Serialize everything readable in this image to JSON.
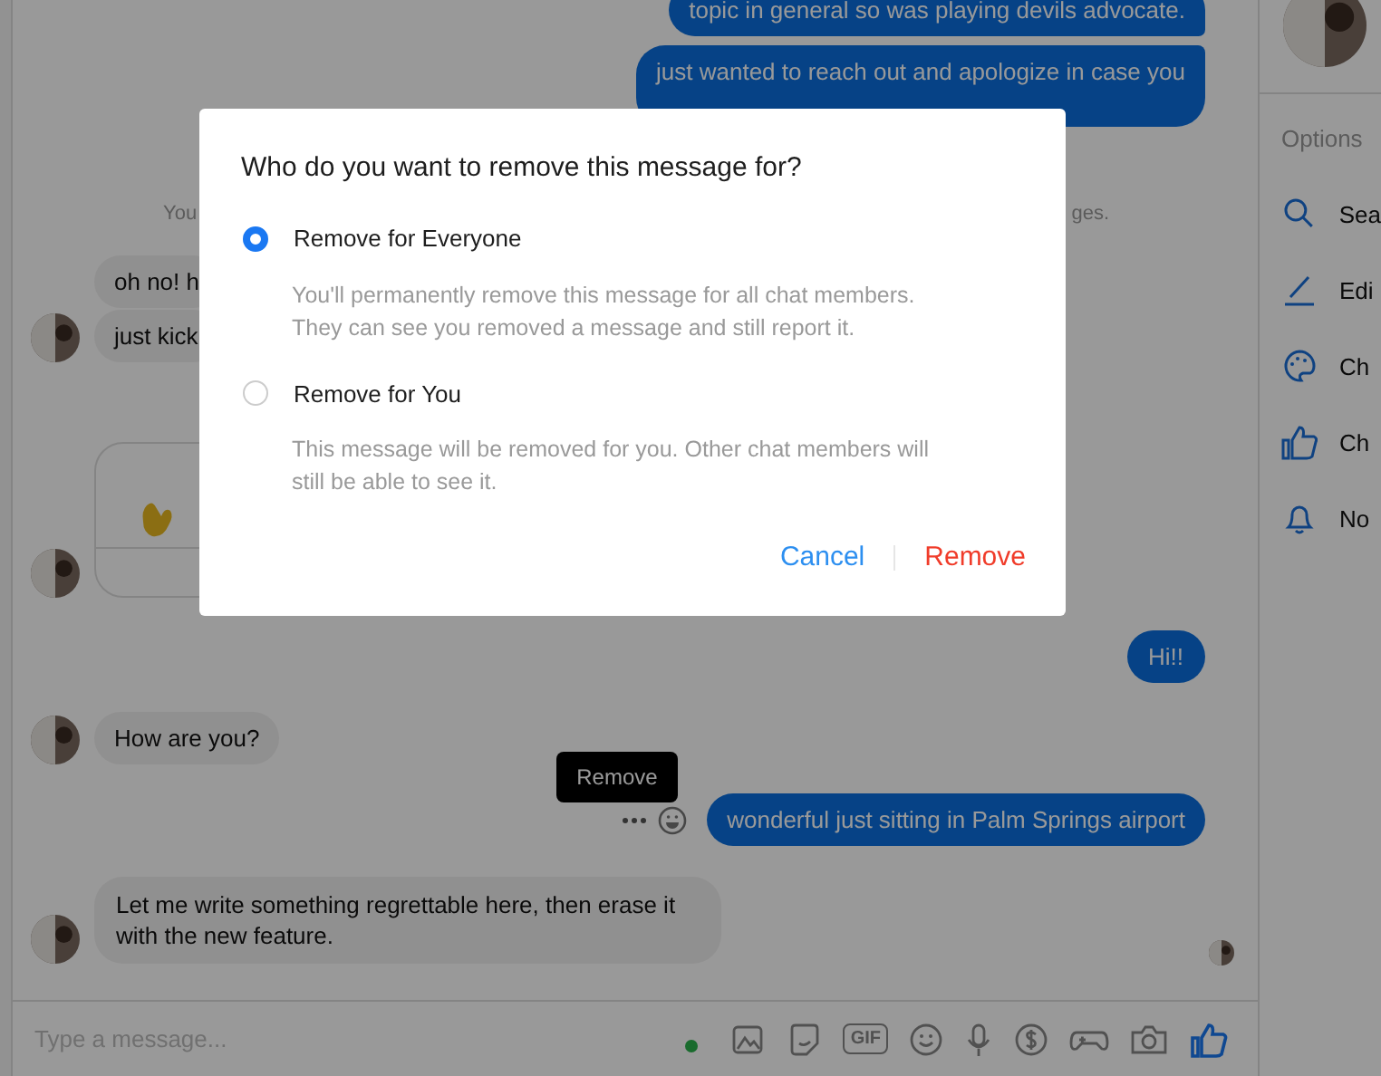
{
  "messages": [
    {
      "kind": "sent",
      "text": "topic in general so was playing devils advocate."
    },
    {
      "kind": "sent",
      "text": "just wanted to reach out and apologize in case you"
    },
    {
      "kind": "notice",
      "parts": [
        "You",
        "ges."
      ]
    },
    {
      "kind": "received",
      "texts": [
        "oh no! h",
        "just kick"
      ]
    },
    {
      "kind": "card"
    },
    {
      "kind": "sent",
      "text": "Hi!!"
    },
    {
      "kind": "received",
      "texts": [
        "How are you?"
      ]
    },
    {
      "kind": "sent",
      "text": "wonderful just sitting in Palm Springs airport",
      "tooltip": "Remove"
    },
    {
      "kind": "received",
      "texts": [
        "Let me write something regrettable here, then erase it with the new feature."
      ]
    },
    {
      "kind": "seen"
    }
  ],
  "composer": {
    "placeholder": "Type a message...",
    "online": true,
    "gif": "GIF"
  },
  "sidebar": {
    "heading": "Options",
    "items": [
      {
        "kind": "search",
        "label": "Sea"
      },
      {
        "kind": "pencil",
        "label": "Edi"
      },
      {
        "kind": "palette",
        "label": "Ch"
      },
      {
        "kind": "like",
        "label": "Ch"
      },
      {
        "kind": "bell",
        "label": "No"
      }
    ]
  },
  "dialog": {
    "title": "Who do you want to remove this message for?",
    "options": [
      {
        "label": "Remove for Everyone",
        "description": "You'll permanently remove this message for all chat members. They can see you removed a message and still report it.",
        "selected": true
      },
      {
        "label": "Remove for You",
        "description": "This message will be removed for you. Other chat members will still be able to see it.",
        "selected": false
      }
    ],
    "buttons": [
      {
        "kind": "cancel",
        "label": "Cancel"
      },
      {
        "kind": "danger",
        "label": "Remove"
      }
    ]
  }
}
